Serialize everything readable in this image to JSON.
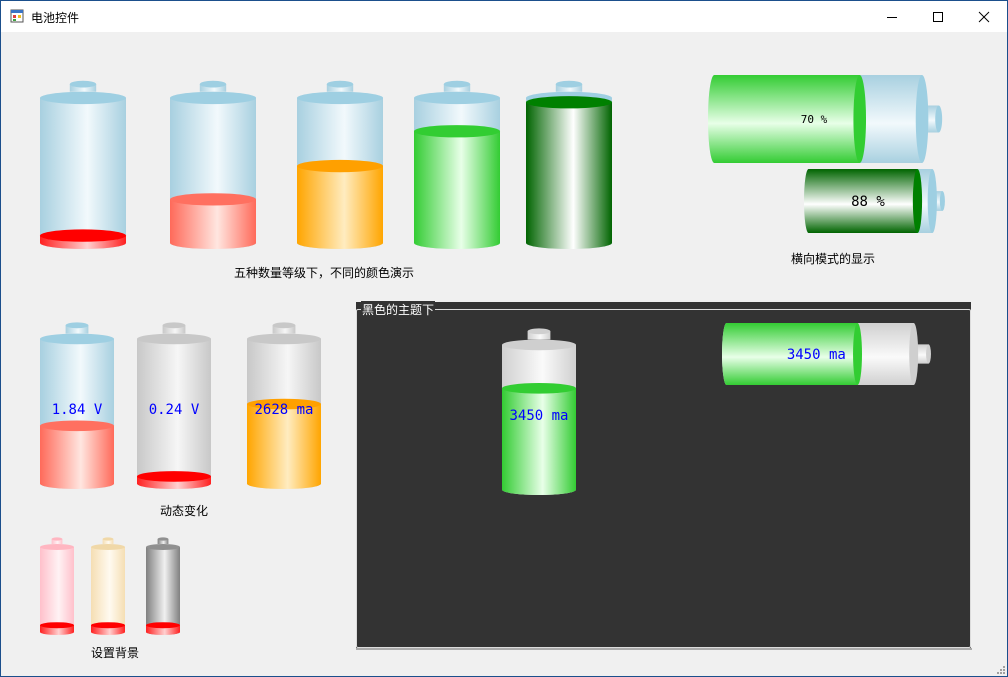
{
  "window": {
    "title": "电池控件"
  },
  "labels": {
    "levels": "五种数量等级下，不同的颜色演示",
    "horizontal": "横向模式的显示",
    "dynamic": "动态变化",
    "background": "设置背景",
    "dark_group": "黑色的主题下"
  },
  "batteries": {
    "levels": [
      {
        "level": 0.05,
        "fill": "red"
      },
      {
        "level": 0.3,
        "fill": "salmon"
      },
      {
        "level": 0.53,
        "fill": "orange"
      },
      {
        "level": 0.77,
        "fill": "lightgreen"
      },
      {
        "level": 0.97,
        "fill": "darkgreen"
      }
    ],
    "horizontal": [
      {
        "level": 0.7,
        "text": "70 %",
        "fill": "lightgreen"
      },
      {
        "level": 0.88,
        "text": "88 %",
        "fill": "darkgreen"
      }
    ],
    "dynamic": [
      {
        "level": 0.4,
        "text": "1.84 V",
        "fill": "salmon",
        "body": "blue"
      },
      {
        "level": 0.05,
        "text": "0.24 V",
        "fill": "red",
        "body": "gray"
      },
      {
        "level": 0.55,
        "text": "2628 ma",
        "fill": "orange",
        "body": "gray"
      }
    ],
    "background": [
      {
        "level": 0.08,
        "fill": "red",
        "body": "pink"
      },
      {
        "level": 0.08,
        "fill": "red",
        "body": "wheat"
      },
      {
        "level": 0.08,
        "fill": "red",
        "body": "darkgray"
      }
    ],
    "dark": [
      {
        "level": 0.7,
        "text": "3450 ma",
        "fill": "lightgreen",
        "body": "lightgray"
      },
      {
        "level": 0.7,
        "text": "3450 ma",
        "fill": "lightgreen",
        "body": "lightgray"
      }
    ]
  },
  "palette": {
    "red": {
      "edge": "#ff2020",
      "mid": "#ffd0d0",
      "cap": "#ff0000"
    },
    "salmon": {
      "edge": "#ff6a5a",
      "mid": "#ffe6e0",
      "cap": "#ff7060"
    },
    "orange": {
      "edge": "#ffa500",
      "mid": "#ffecc0",
      "cap": "#ffa000"
    },
    "lightgreen": {
      "edge": "#33cc33",
      "mid": "#e8ffe8",
      "cap": "#32cd32"
    },
    "darkgreen": {
      "edge": "#006400",
      "mid": "#ffffff",
      "cap": "#008000"
    },
    "blue": {
      "edge": "#a8d0e0",
      "mid": "#f2f9fc",
      "cap": "#9ecfe2"
    },
    "gray": {
      "edge": "#c8c8c8",
      "mid": "#f6f6f6",
      "cap": "#c8c8c8"
    },
    "lightgray": {
      "edge": "#d0d0d0",
      "mid": "#fafafa",
      "cap": "#cfcfcf"
    },
    "pink": {
      "edge": "#ffc0cb",
      "mid": "#fff2f4",
      "cap": "#ffb6c1"
    },
    "wheat": {
      "edge": "#f5deb3",
      "mid": "#fffaf0",
      "cap": "#f0d8a8"
    },
    "darkgray": {
      "edge": "#808080",
      "mid": "#f0f0f0",
      "cap": "#909090"
    }
  },
  "text_color": "#0000ff"
}
